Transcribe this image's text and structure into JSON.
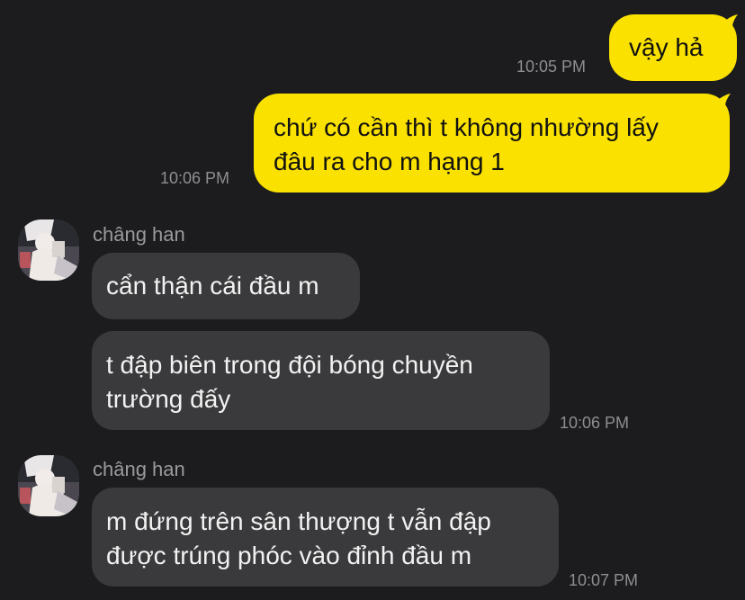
{
  "messages": {
    "m1": {
      "text": "vậy hả",
      "time": "10:05 PM"
    },
    "m2": {
      "text": "chứ có cần thì t không nhường lấy\nđâu ra cho m hạng 1",
      "time": "10:06 PM"
    },
    "group1": {
      "sender": "châng han",
      "m3": {
        "text": "cẩn thận cái đầu m"
      },
      "m4": {
        "text": "t đập biên trong đội bóng chuyền\ntrường đấy",
        "time": "10:06 PM"
      }
    },
    "group2": {
      "sender": "châng han",
      "m5": {
        "text": "m đứng trên sân thượng t vẫn đập\nđược trúng phóc vào đỉnh đầu m",
        "time": "10:07 PM"
      }
    }
  },
  "colors": {
    "background": "#1c1c1e",
    "outgoing_bubble": "#fae100",
    "incoming_bubble": "#3a3a3c",
    "timestamp": "#8e8e93"
  },
  "icons": {
    "avatar": "user-avatar-photo"
  }
}
